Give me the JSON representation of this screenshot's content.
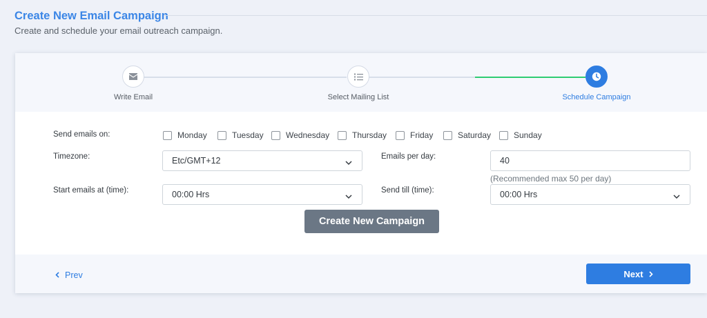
{
  "header": {
    "title": "Create New Email Campaign",
    "subtitle": "Create and schedule your email outreach campaign."
  },
  "steps": [
    {
      "label": "Write Email",
      "icon": "envelope-icon",
      "state": "complete"
    },
    {
      "label": "Select Mailing List",
      "icon": "list-icon",
      "state": "complete"
    },
    {
      "label": "Schedule Campaign",
      "icon": "clock-icon",
      "state": "active"
    }
  ],
  "form": {
    "send_on_label": "Send emails on:",
    "days": [
      {
        "label": "Monday",
        "checked": false
      },
      {
        "label": "Tuesday",
        "checked": false
      },
      {
        "label": "Wednesday",
        "checked": false
      },
      {
        "label": "Thursday",
        "checked": false
      },
      {
        "label": "Friday",
        "checked": false
      },
      {
        "label": "Saturday",
        "checked": false
      },
      {
        "label": "Sunday",
        "checked": false
      }
    ],
    "timezone_label": "Timezone:",
    "timezone_value": "Etc/GMT+12",
    "emails_per_day_label": "Emails per day:",
    "emails_per_day_value": "40",
    "emails_per_day_hint": "(Recommended max 50 per day)",
    "start_label": "Start emails at (time):",
    "start_value": "00:00 Hrs",
    "till_label": "Send till (time):",
    "till_value": "00:00 Hrs",
    "create_button": "Create New Campaign"
  },
  "footer": {
    "prev_label": "Prev",
    "next_label": "Next"
  },
  "colors": {
    "accent": "#2e7de1",
    "complete_line": "#2ecc71",
    "create_button": "#6b7785",
    "background": "#eef1f8"
  }
}
